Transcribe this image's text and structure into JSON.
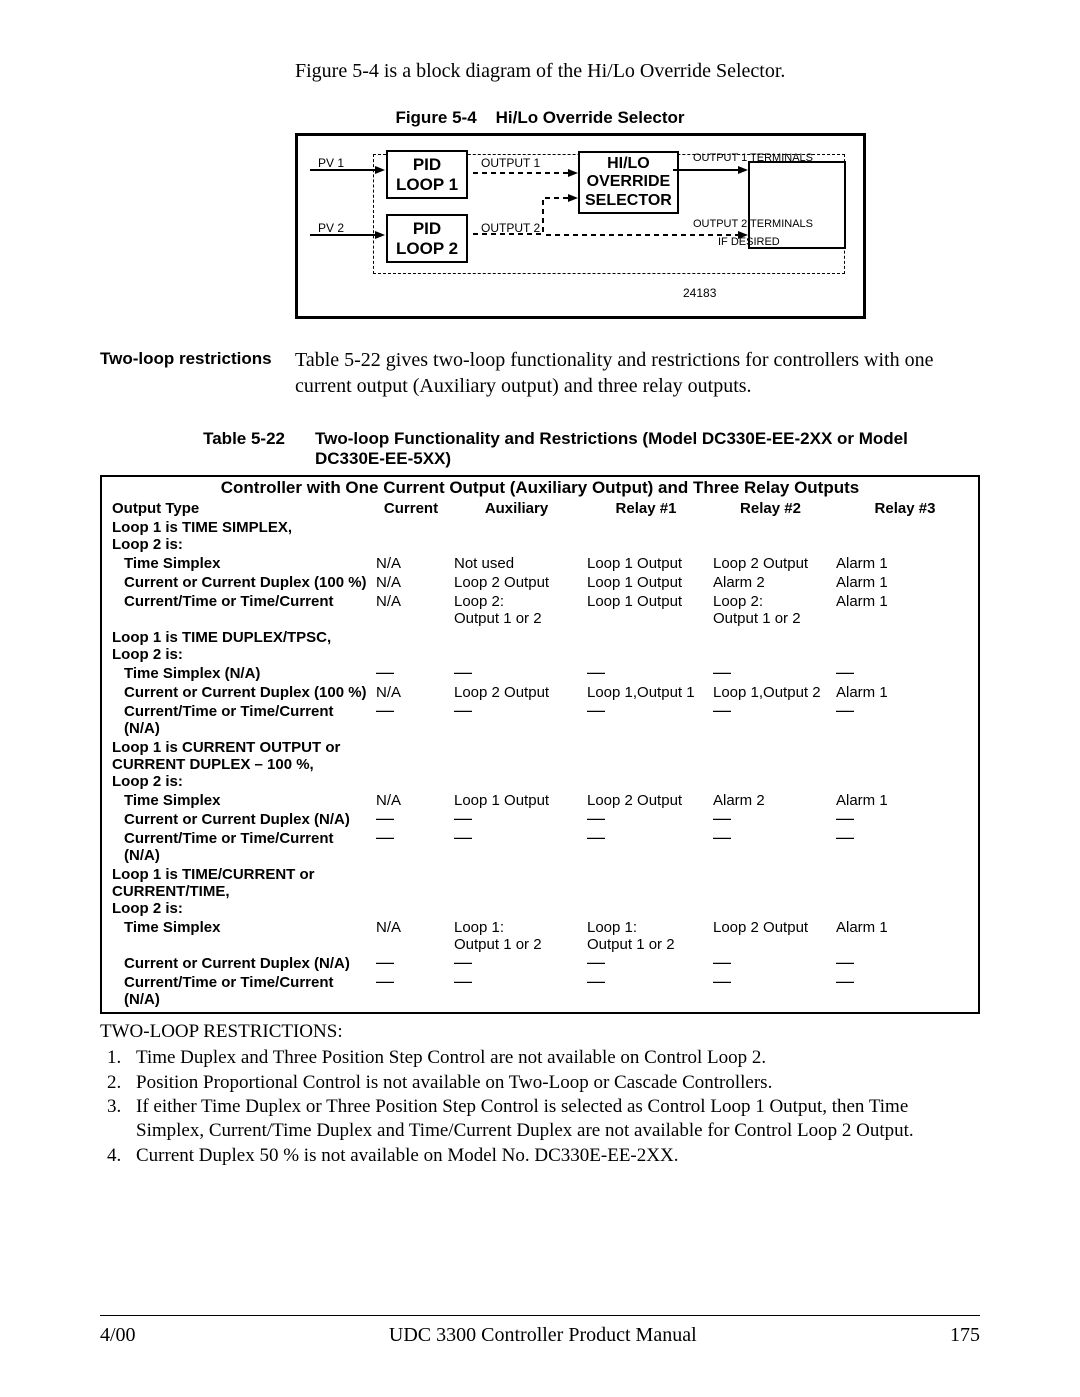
{
  "intro": "Figure 5-4 is a block diagram of the Hi/Lo Override Selector.",
  "figure": {
    "label": "Figure 5-4",
    "title": "Hi/Lo Override Selector",
    "pv1": "PV 1",
    "pv2": "PV 2",
    "pid1_l1": "PID",
    "pid1_l2": "LOOP 1",
    "pid2_l1": "PID",
    "pid2_l2": "LOOP 2",
    "out1": "OUTPUT 1",
    "out2": "OUTPUT 2",
    "hilo_l1": "HI/LO",
    "hilo_l2": "OVERRIDE",
    "hilo_l3": "SELECTOR",
    "term1": "OUTPUT 1 TERMINALS",
    "term2": "OUTPUT 2 TERMINALS",
    "ifdes": "IF DESIRED",
    "num": "24183"
  },
  "twoloop": {
    "head": "Two-loop restrictions",
    "body": "Table 5-22 gives two-loop functionality and restrictions for controllers with one current output (Auxiliary output) and three relay outputs."
  },
  "table": {
    "label": "Table 5-22",
    "caption": "Two-loop Functionality and Restrictions (Model DC330E-EE-2XX or Model DC330E-EE-5XX)",
    "title_row": "Controller with One Current Output (Auxiliary Output) and Three Relay Outputs",
    "headers": [
      "Output Type",
      "Current",
      "Auxiliary",
      "Relay #1",
      "Relay #2",
      "Relay #3"
    ],
    "g1": "Loop 1 is TIME SIMPLEX, Loop 2 is:",
    "g1r1": [
      "Time Simplex",
      "N/A",
      "Not used",
      "Loop 1 Output",
      "Loop 2 Output",
      "Alarm 1"
    ],
    "g1r2": [
      "Current or Current Duplex (100 %)",
      "N/A",
      "Loop 2 Output",
      "Loop 1 Output",
      "Alarm 2",
      "Alarm 1"
    ],
    "g1r3": [
      "Current/Time or Time/Current",
      "N/A",
      "Loop 2: Output 1 or 2",
      "Loop 1 Output",
      "Loop 2: Output 1 or 2",
      "Alarm 1"
    ],
    "g2": "Loop 1 is TIME DUPLEX/TPSC, Loop 2 is:",
    "g2r1": [
      "Time Simplex (N/A)",
      "—",
      "—",
      "—",
      "—",
      "—"
    ],
    "g2r2": [
      "Current or Current Duplex (100 %)",
      "N/A",
      "Loop 2 Output",
      "Loop 1,Output 1",
      "Loop 1,Output 2",
      "Alarm 1"
    ],
    "g2r3": [
      "Current/Time or Time/Current (N/A)",
      "—",
      "—",
      "—",
      "—",
      "—"
    ],
    "g3a": "Loop 1 is CURRENT OUTPUT or",
    "g3b": "CURRENT DUPLEX – 100 %,",
    "g3c": "Loop 2 is:",
    "g3r1": [
      "Time Simplex",
      "N/A",
      "Loop 1 Output",
      "Loop 2 Output",
      "Alarm 2",
      "Alarm 1"
    ],
    "g3r2": [
      "Current or Current Duplex (N/A)",
      "—",
      "—",
      "—",
      "—",
      "—"
    ],
    "g3r3": [
      "Current/Time or Time/Current (N/A)",
      "—",
      "—",
      "—",
      "—",
      "—"
    ],
    "g4a": "Loop 1 is TIME/CURRENT or",
    "g4b": "CURRENT/TIME,",
    "g4c": "Loop 2 is:",
    "g4r1": [
      "Time Simplex",
      "N/A",
      "Loop 1: Output 1 or 2",
      "Loop 1: Output 1 or 2",
      "Loop 2 Output",
      "Alarm 1"
    ],
    "g4r2": [
      "Current or Current Duplex (N/A)",
      "—",
      "—",
      "—",
      "—",
      "—"
    ],
    "g4r3": [
      "Current/Time or Time/Current (N/A)",
      "—",
      "—",
      "—",
      "—",
      "—"
    ]
  },
  "restrictions": {
    "head": "TWO-LOOP RESTRICTIONS:",
    "items": [
      "Time Duplex and Three Position Step Control are not available on Control Loop 2.",
      "Position Proportional Control is not available on Two-Loop or Cascade Controllers.",
      "If either Time Duplex or Three Position Step Control is selected as Control Loop 1 Output, then Time Simplex, Current/Time Duplex and Time/Current Duplex are not available for Control Loop 2 Output.",
      "Current Duplex 50 % is not available on Model No. DC330E-EE-2XX."
    ]
  },
  "footer": {
    "left": "4/00",
    "center": "UDC 3300 Controller Product Manual",
    "right": "175"
  }
}
